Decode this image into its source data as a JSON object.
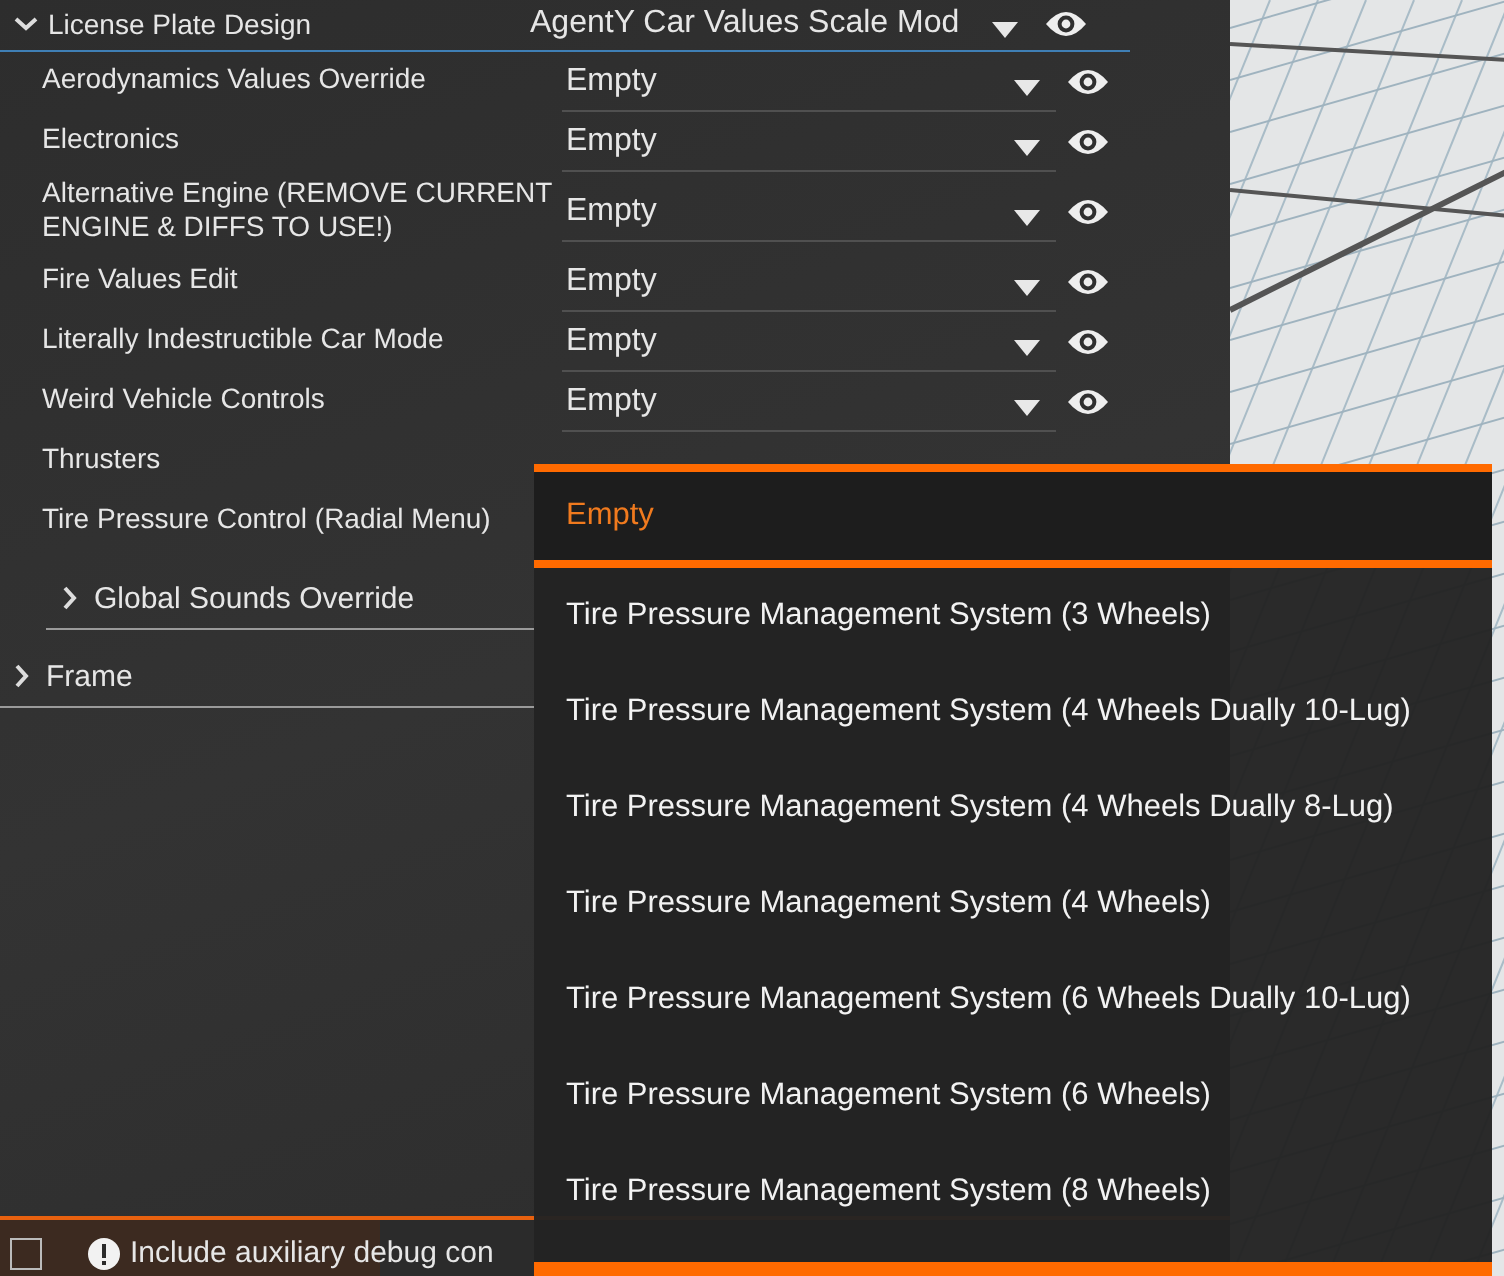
{
  "header": {
    "label": "License Plate Design",
    "value": "AgentY Car Values Scale Mod",
    "expanded": true,
    "groups": [
      {
        "label": "Global Sounds Override",
        "expanded": false
      }
    ]
  },
  "rows": [
    {
      "label": "Aerodynamics Values Override",
      "value": "Empty"
    },
    {
      "label": "Electronics",
      "value": "Empty"
    },
    {
      "label": "Alternative Engine (REMOVE CURRENT ENGINE & DIFFS TO USE!)",
      "value": "Empty"
    },
    {
      "label": "Fire Values Edit",
      "value": "Empty"
    },
    {
      "label": "Literally Indestructible Car Mode",
      "value": "Empty"
    },
    {
      "label": "Weird Vehicle Controls",
      "value": "Empty"
    },
    {
      "label": "Thrusters"
    },
    {
      "label": "Tire Pressure Control (Radial Menu)"
    }
  ],
  "groups": [
    {
      "label": "Frame",
      "expanded": false
    }
  ],
  "footer": {
    "checkbox_checked": false,
    "label": "Include auxiliary debug con"
  },
  "dropdown": {
    "options": [
      {
        "label": "Empty",
        "selected": true
      },
      {
        "label": "Tire Pressure Management System (3 Wheels)",
        "selected": false
      },
      {
        "label": "Tire Pressure Management System (4 Wheels Dually 10-Lug)",
        "selected": false
      },
      {
        "label": "Tire Pressure Management System (4 Wheels Dually 8-Lug)",
        "selected": false
      },
      {
        "label": "Tire Pressure Management System (4 Wheels)",
        "selected": false
      },
      {
        "label": "Tire Pressure Management System (6 Wheels Dually 10-Lug)",
        "selected": false
      },
      {
        "label": "Tire Pressure Management System (6 Wheels)",
        "selected": false
      },
      {
        "label": "Tire Pressure Management System (8 Wheels)",
        "selected": false
      }
    ]
  }
}
